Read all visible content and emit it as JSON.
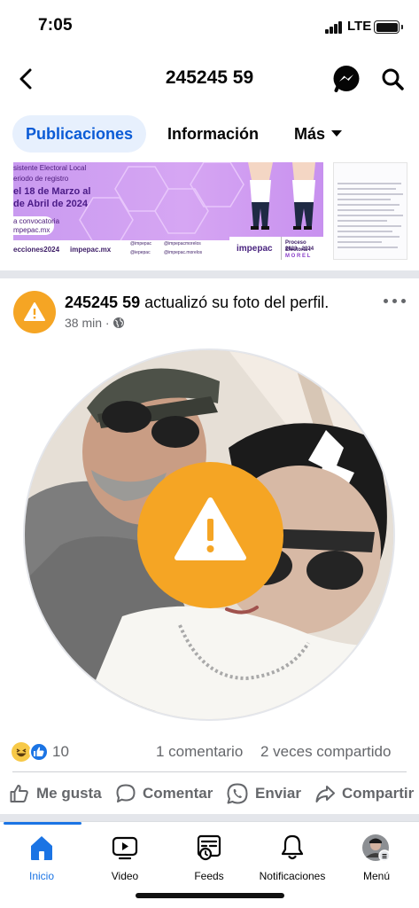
{
  "status_bar": {
    "time": "7:05",
    "network": "LTE"
  },
  "header": {
    "title": "245245 59",
    "back_icon": "chevron-left-icon",
    "messenger_icon": "messenger-icon",
    "search_icon": "search-icon"
  },
  "tabs": [
    {
      "label": "Publicaciones",
      "active": true
    },
    {
      "label": "Información",
      "active": false
    },
    {
      "label": "Más",
      "active": false
    }
  ],
  "banner": {
    "line1": "sistente Electoral Local",
    "line2": "eriodo de registro",
    "line3": "el 18 de Marzo al",
    "line4": "de Abril de 2024",
    "line5": "a convocatoria",
    "line6": "mpepac.mx",
    "footer_hashtag": "ecciones2024",
    "footer_site": "impepac.mx",
    "social1": "@impepac",
    "social2": "@impepacmorelos",
    "social3": "@iepepac",
    "social4": "@impepac.morelos",
    "brand": "impepac",
    "process_line1": "Proceso Electoral I",
    "process_line2": "2023 - 2024",
    "process_line3": "M O R E L"
  },
  "post": {
    "author": "245245 59",
    "action_text": " actualizó su foto del perfil.",
    "time": "38 min",
    "separator": " · "
  },
  "reactions": {
    "count": "10",
    "comments": "1 comentario",
    "shares": "2 veces compartido"
  },
  "actions": [
    {
      "label": "Me gusta",
      "icon": "thumbs-up-icon"
    },
    {
      "label": "Comentar",
      "icon": "comment-icon"
    },
    {
      "label": "Enviar",
      "icon": "whatsapp-icon"
    },
    {
      "label": "Compartir",
      "icon": "share-icon"
    }
  ],
  "nav": [
    {
      "label": "Inicio",
      "icon": "home-icon",
      "active": true
    },
    {
      "label": "Video",
      "icon": "video-icon",
      "active": false
    },
    {
      "label": "Feeds",
      "icon": "feeds-icon",
      "active": false
    },
    {
      "label": "Notificaciones",
      "icon": "bell-icon",
      "active": false
    },
    {
      "label": "Menú",
      "icon": "menu-avatar-icon",
      "active": false
    }
  ],
  "colors": {
    "accent": "#1b74e4",
    "warning": "#f5a524",
    "muted": "#65676b",
    "banner": "#c99af0"
  }
}
